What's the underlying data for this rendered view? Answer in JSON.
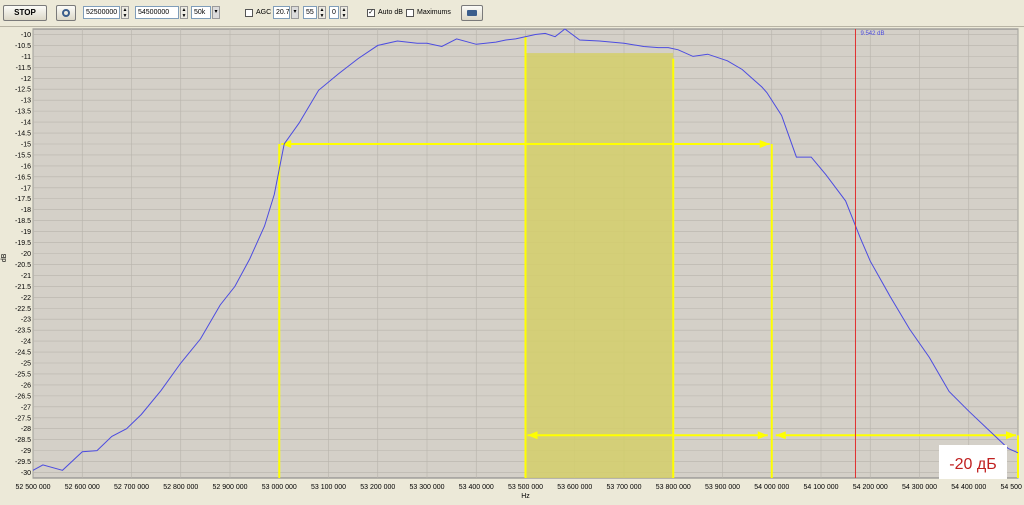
{
  "toolbar": {
    "stop_label": "STOP",
    "freq_start": "52500000",
    "freq_stop": "54500000",
    "rbw": "50k",
    "agc_label": "AGC",
    "agc_value": "20.7",
    "agc_level": "55",
    "agc_step": "0",
    "auto_db_label": "Auto dB",
    "auto_db_checked": "✓",
    "maximums_label": "Maximums"
  },
  "colors": {
    "trace": "#4c4ce0",
    "marker_red": "#e03030",
    "annotation_yellow": "#ffff00",
    "band_fill": "#d4cf6a",
    "plot_bg": "#d4d0c8",
    "grid": "#b8b4ac"
  },
  "chart_data": {
    "type": "line",
    "xlabel": "Hz",
    "ylabel": "dB",
    "xlim": [
      52500000,
      54500000
    ],
    "ylim": [
      -30.25,
      -9.75
    ],
    "x_ticks": [
      52500000,
      52600000,
      52700000,
      52800000,
      52900000,
      53000000,
      53100000,
      53200000,
      53300000,
      53400000,
      53500000,
      53600000,
      53700000,
      53800000,
      53900000,
      54000000,
      54100000,
      54200000,
      54300000,
      54400000,
      54500000
    ],
    "x_tick_labels": [
      "52 500 000",
      "52 600 000",
      "52 700 000",
      "52 800 000",
      "52 900 000",
      "53 000 000",
      "53 100 000",
      "53 200 000",
      "53 300 000",
      "53 400 000",
      "53 500 000",
      "53 600 000",
      "53 700 000",
      "53 800 000",
      "53 900 000",
      "54 000 000",
      "54 100 000",
      "54 200 000",
      "54 300 000",
      "54 400 000",
      "54 500 000"
    ],
    "y_ticks": [
      -10,
      -10.5,
      -11,
      -11.5,
      -12,
      -12.5,
      -13,
      -13.5,
      -14,
      -14.5,
      -15,
      -15.5,
      -16,
      -16.5,
      -17,
      -17.5,
      -18,
      -18.5,
      -19,
      -19.5,
      -20,
      -20.5,
      -21,
      -21.5,
      -22,
      -22.5,
      -23,
      -23.5,
      -24,
      -24.5,
      -25,
      -25.5,
      -26,
      -26.5,
      -27,
      -27.5,
      -28,
      -28.5,
      -29,
      -29.5,
      -30
    ],
    "y_tick_labels": [
      "-10",
      "-10.5",
      "-11",
      "-11.5",
      "-12",
      "-12.5",
      "-13",
      "-13.5",
      "-14",
      "-14.5",
      "-15",
      "-15.5",
      "-16",
      "-16.5",
      "-17",
      "-17.5",
      "-18",
      "-18.5",
      "-19",
      "-19.5",
      "-20",
      "-20.5",
      "-21",
      "-21.5",
      "-22",
      "-22.5",
      "-23",
      "-23.5",
      "-24",
      "-24.5",
      "-25",
      "-25.5",
      "-26",
      "-26.5",
      "-27",
      "-27.5",
      "-28",
      "-28.5",
      "-29",
      "-29.5",
      "-30"
    ],
    "grid": true,
    "series": [
      {
        "x": [
          52500000,
          52520000,
          52560000,
          52600000,
          52630000,
          52660000,
          52690000,
          52720000,
          52760000,
          52800000,
          52840000,
          52880000,
          52910000,
          52940000,
          52970000,
          52990000,
          53010000,
          53040000,
          53080000,
          53120000,
          53160000,
          53200000,
          53240000,
          53280000,
          53300000,
          53330000,
          53360000,
          53400000,
          53440000,
          53460000,
          53480000,
          53520000,
          53540000,
          53560000,
          53580000,
          53610000,
          53650000,
          53700000,
          53740000,
          53770000,
          53790000,
          53810000,
          53840000,
          53870000,
          53910000,
          53940000,
          53960000,
          53980000,
          53990000,
          54020000,
          54050000,
          54080000,
          54110000,
          54150000,
          54180000,
          54200000,
          54240000,
          54280000,
          54320000,
          54360000,
          54400000,
          54440000,
          54480000,
          54500000
        ],
        "y": [
          -29.9,
          -29.65,
          -29.9,
          -29.05,
          -29,
          -28.35,
          -28,
          -27.35,
          -26.25,
          -25,
          -23.9,
          -22.35,
          -21.5,
          -20.25,
          -18.75,
          -17.3,
          -15,
          -14.05,
          -12.55,
          -11.8,
          -11.1,
          -10.5,
          -10.3,
          -10.4,
          -10.4,
          -10.55,
          -10.2,
          -10.45,
          -10.35,
          -10.25,
          -10.2,
          -10,
          -9.95,
          -10.1,
          -9.75,
          -10.25,
          -10.3,
          -10.4,
          -10.55,
          -10.6,
          -10.6,
          -10.7,
          -11,
          -10.9,
          -11.2,
          -11.6,
          -12,
          -12.4,
          -12.65,
          -13.7,
          -15.6,
          -15.6,
          -16.4,
          -17.6,
          -19.3,
          -20.35,
          -21.95,
          -23.45,
          -24.75,
          -26.3,
          -27.2,
          -28.05,
          -28.9,
          -29.1
        ]
      }
    ],
    "annotations": {
      "marker_x": 54170000,
      "marker_label": "9.542 dB",
      "shaded_band": {
        "x_start": 53500000,
        "x_end": 53800000,
        "y_top": -10.85
      },
      "upper_span": {
        "x_start": 53000000,
        "x_end": 54000000,
        "y": -15
      },
      "lower_span": {
        "x_start": 53500000,
        "x_end": 54500000,
        "y": -28.3
      },
      "callout_label": "-20 дБ"
    }
  }
}
